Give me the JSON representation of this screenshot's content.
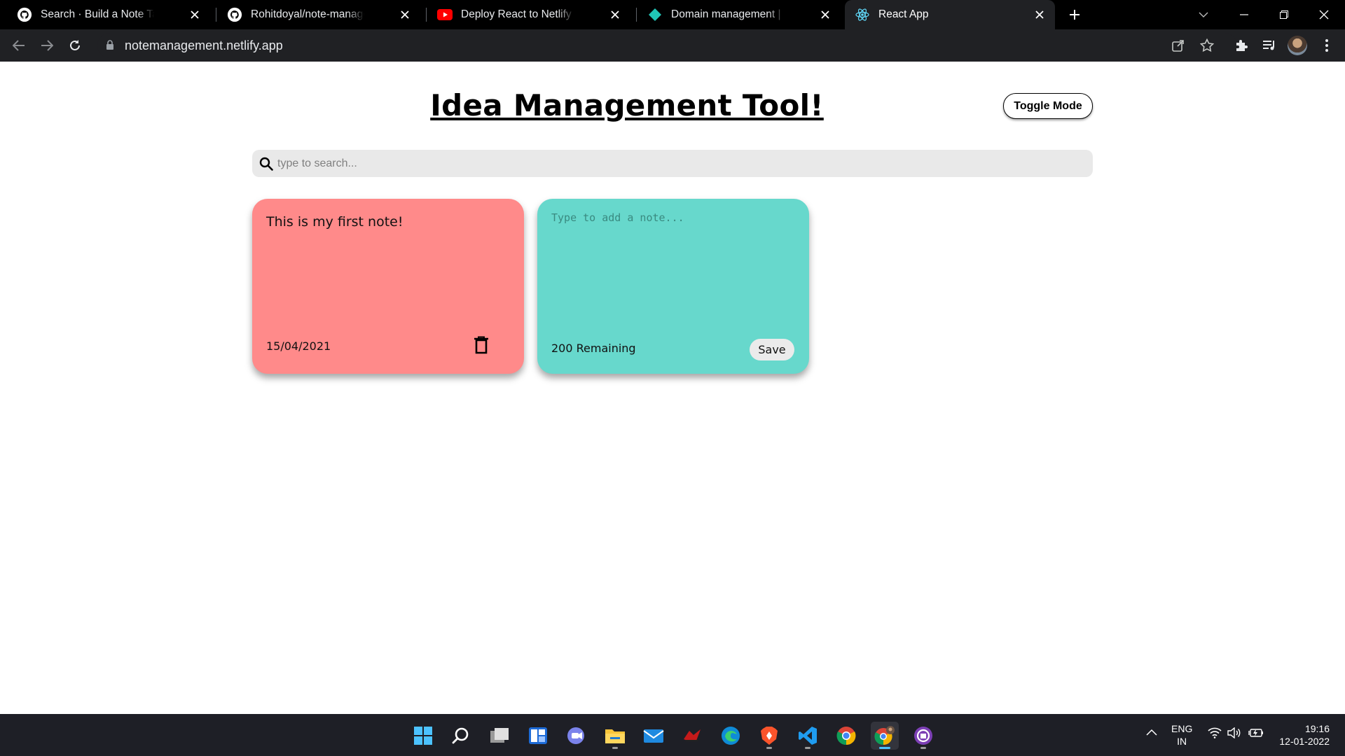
{
  "browser": {
    "tabs": [
      {
        "title": "Search · Build a Note Taking App",
        "icon": "github-icon"
      },
      {
        "title": "Rohitdoyal/note-management-app",
        "icon": "github-icon"
      },
      {
        "title": "Deploy React to Netlify in less than",
        "icon": "youtube-icon"
      },
      {
        "title": "Domain management | Site settings",
        "icon": "netlify-icon"
      },
      {
        "title": "React App",
        "icon": "react-icon"
      }
    ],
    "url": "notemanagement.netlify.app"
  },
  "app": {
    "title": "Idea Management Tool!",
    "toggle_label": "Toggle Mode",
    "search_placeholder": "type to search...",
    "notes": [
      {
        "text": "This is my first note!",
        "date": "15/04/2021",
        "color": "#ff8a8a"
      }
    ],
    "new_note": {
      "placeholder": "Type to add a note...",
      "remaining": "200 Remaining",
      "save_label": "Save",
      "color": "#67d8cc"
    }
  },
  "taskbar": {
    "apps": [
      "start-icon",
      "search-icon",
      "task-view-icon",
      "widgets-icon",
      "teams-chat-icon",
      "file-explorer-icon",
      "mail-icon",
      "game-icon",
      "edge-icon",
      "brave-icon",
      "vscode-icon",
      "chrome-icon",
      "chrome-profile-icon",
      "github-desktop-icon"
    ],
    "lang_top": "ENG",
    "lang_bottom": "IN",
    "time": "19:16",
    "date": "12-01-2022"
  }
}
